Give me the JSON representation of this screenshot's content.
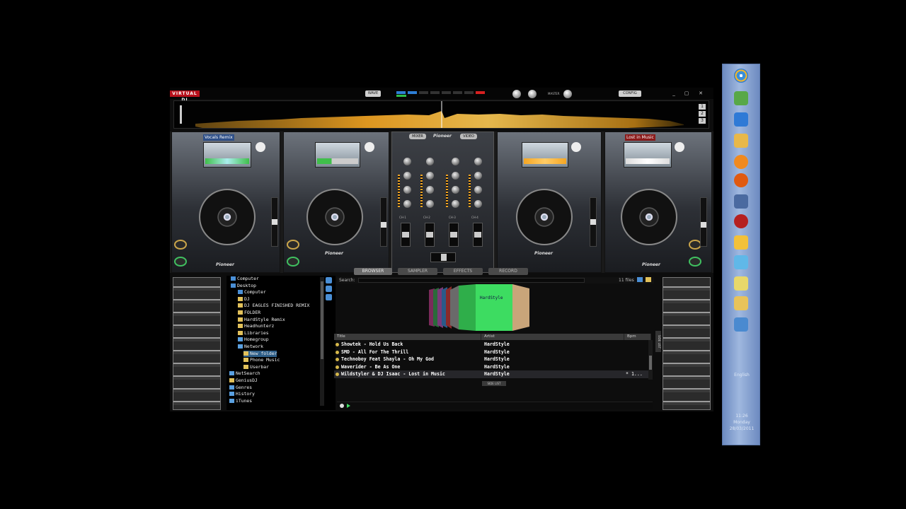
{
  "app": {
    "logo": "VIRTUAL DJ",
    "wave_btn": "WAVE",
    "master_label": "MASTER",
    "config_btn": "CONFIG",
    "window_btns": [
      "_",
      "▢",
      "✕"
    ],
    "wave_numbers": [
      "1",
      "2",
      "3"
    ]
  },
  "decks": {
    "deck1_title": "Vocals Remix",
    "deck4_title": "Lost in Music",
    "brand": "Pioneer"
  },
  "mixer": {
    "tab_mixer": "MIXER",
    "tab_video": "VIDEO",
    "brand": "Pioneer",
    "channels": [
      "CH-1",
      "CH-2",
      "CH-3",
      "CH-4"
    ]
  },
  "browser_tabs": [
    {
      "label": "BROWSER",
      "active": true
    },
    {
      "label": "SAMPLER",
      "active": false
    },
    {
      "label": "EFFECTS",
      "active": false
    },
    {
      "label": "RECORD",
      "active": false
    }
  ],
  "tree": [
    {
      "label": "Computer",
      "icon": "computer-icon",
      "indent": 0
    },
    {
      "label": "Desktop",
      "icon": "desktop-icon",
      "indent": 0
    },
    {
      "label": "Computer",
      "icon": "computer-icon",
      "indent": 1
    },
    {
      "label": "DJ",
      "icon": "folder-icon",
      "indent": 1
    },
    {
      "label": "DJ EAGLES FINISHED REMIX",
      "icon": "folder-icon",
      "indent": 1
    },
    {
      "label": "FOLDER",
      "icon": "folder-icon",
      "indent": 1
    },
    {
      "label": "HardStyle Remix",
      "icon": "folder-icon",
      "indent": 1
    },
    {
      "label": "Headhunterz",
      "icon": "folder-icon",
      "indent": 1
    },
    {
      "label": "Libraries",
      "icon": "folder-icon",
      "indent": 1
    },
    {
      "label": "Homegroup",
      "icon": "homegroup-icon",
      "indent": 1
    },
    {
      "label": "Network",
      "icon": "network-icon",
      "indent": 1
    },
    {
      "label": "New folder",
      "icon": "folder-icon",
      "indent": 2,
      "selected": true
    },
    {
      "label": "Phone Music",
      "icon": "folder-icon",
      "indent": 2
    },
    {
      "label": "Userbar",
      "icon": "folder-icon",
      "indent": 2
    },
    {
      "label": "NetSearch",
      "icon": "netsearch-icon",
      "indent": 0
    },
    {
      "label": "GeniusDJ",
      "icon": "geniusdj-icon",
      "indent": 0
    },
    {
      "label": "Genres",
      "icon": "genres-icon",
      "indent": 0
    },
    {
      "label": "History",
      "icon": "history-icon",
      "indent": 0
    },
    {
      "label": "iTunes",
      "icon": "itunes-icon",
      "indent": 0
    }
  ],
  "search": {
    "label": "Search:",
    "value": "",
    "files_count": "11 files"
  },
  "coverflow": {
    "center_label": "HardStyle"
  },
  "table": {
    "headers": {
      "title": "Title",
      "artist": "Artist",
      "bpm": "Bpm"
    },
    "rows": [
      {
        "title": "Showtek - Hold Us Back",
        "artist": "HardStyle",
        "bpm": ""
      },
      {
        "title": "SMD  - All For The Thrill",
        "artist": "HardStyle",
        "bpm": ""
      },
      {
        "title": "Technoboy Feat Shayla - Oh My God",
        "artist": "HardStyle",
        "bpm": ""
      },
      {
        "title": "Waverider - Be As One",
        "artist": "HardStyle",
        "bpm": ""
      },
      {
        "title": "Wildstyler & DJ Isaac - Lost in Music",
        "artist": "HardStyle",
        "bpm": "* 1..."
      }
    ],
    "side_list": "SIDE LIST",
    "side_list_btn": "SIDE LIST"
  },
  "taskbar": {
    "language": "English",
    "time": "11:26",
    "day": "Monday",
    "date": "28/03/2011"
  },
  "colors": {
    "accent_red": "#b8111c",
    "wave_orange": "#f5a623",
    "taskbar_blue": "#8aa6d4"
  }
}
